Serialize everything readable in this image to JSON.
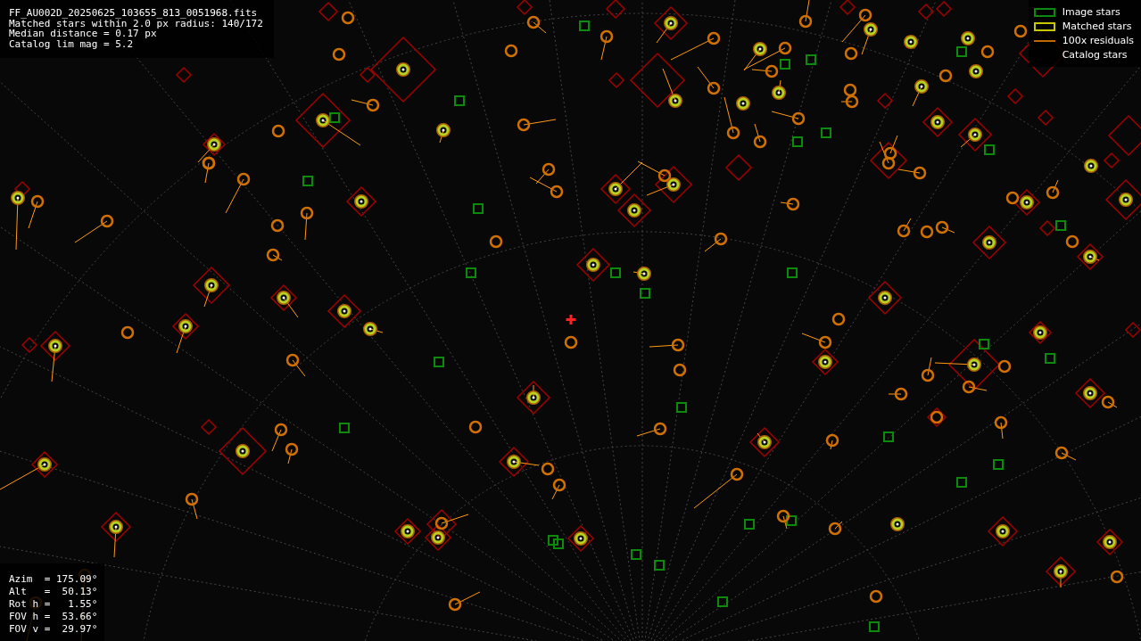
{
  "header": {
    "lines": [
      "FF_AU002D_20250625_103655_813_0051968.fits",
      "Matched stars within 2.0 px radius: 140/172",
      "Median distance = 0.17 px",
      "Catalog lim mag = 5.2"
    ]
  },
  "legend": [
    {
      "kind": "image",
      "label": "Image stars"
    },
    {
      "kind": "matched",
      "label": "Matched stars"
    },
    {
      "kind": "residual",
      "label": "100x residuals"
    },
    {
      "kind": "catalog",
      "label": "Catalog stars"
    }
  ],
  "pointing": {
    "lines": [
      "Azim  = 175.09°",
      "Alt   =  50.13°",
      "Rot h =   1.55°",
      "FOV h =  53.66°",
      "FOV v =  29.97°"
    ]
  }
}
